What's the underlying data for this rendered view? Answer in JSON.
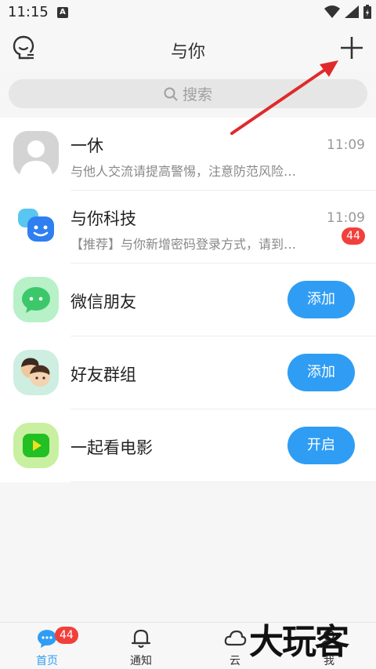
{
  "status_bar": {
    "time": "11:15",
    "notif_letter": "A"
  },
  "header": {
    "title": "与你"
  },
  "search": {
    "placeholder": "搜索"
  },
  "chats": [
    {
      "name": "一休",
      "time": "11:09",
      "preview": "与他人交流请提高警惕，注意防范风险…"
    },
    {
      "name": "与你科技",
      "time": "11:09",
      "preview": "【推荐】与你新增密码登录方式，请到…",
      "badge": "44"
    }
  ],
  "features": [
    {
      "name": "微信朋友",
      "button": "添加",
      "color": "#b8f0c8"
    },
    {
      "name": "好友群组",
      "button": "添加",
      "color": "#cdeee0"
    },
    {
      "name": "一起看电影",
      "button": "开启",
      "color": "#c8f0a0"
    }
  ],
  "bottom_nav": [
    {
      "label": "首页",
      "badge": "44",
      "active": true
    },
    {
      "label": "通知"
    },
    {
      "label": "云"
    },
    {
      "label": "我"
    }
  ],
  "watermark": "大玩客",
  "colors": {
    "accent": "#2f9df4",
    "badge": "#f1403c"
  }
}
